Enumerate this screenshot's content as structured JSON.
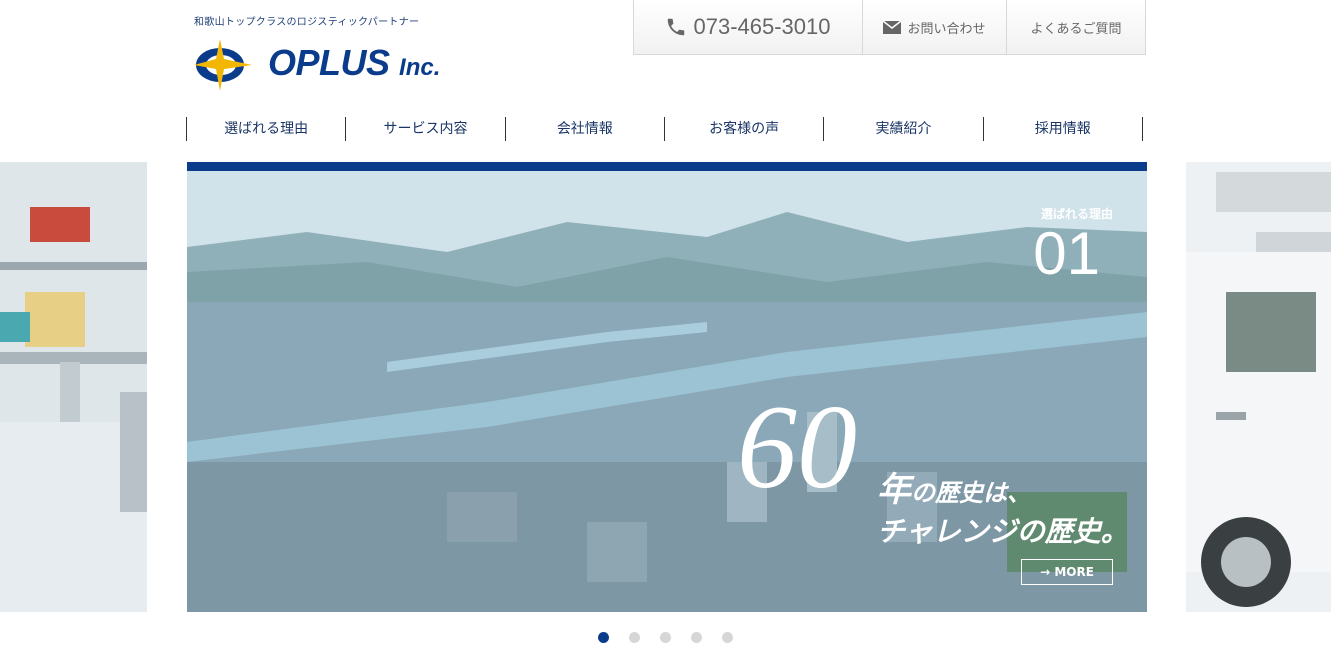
{
  "header": {
    "tagline": "和歌山トップクラスのロジスティックパートナー",
    "logo_text": "OPLUS",
    "logo_suffix": "Inc."
  },
  "topnav": {
    "phone": "073-465-3010",
    "contact": "お問い合わせ",
    "faq": "よくあるご質問"
  },
  "mainnav": [
    "選ばれる理由",
    "サービス内容",
    "会社情報",
    "お客様の声",
    "実績紹介",
    "採用情報"
  ],
  "slider": {
    "reason_label": "選ばれる理由",
    "reason_number": "01",
    "big_number": "60",
    "headline_line1_a": "年",
    "headline_line1_b": "の歴史は、",
    "headline_line2": "チャレンジの歴史。",
    "more_label": "→ MORE",
    "dots_count": 5,
    "active_dot": 0
  },
  "colors": {
    "brand_blue": "#0b3c8c",
    "brand_yellow": "#f2b705",
    "dot_inactive": "#d6d6d6"
  },
  "icons": {
    "phone": "phone-icon",
    "mail": "mail-icon"
  }
}
